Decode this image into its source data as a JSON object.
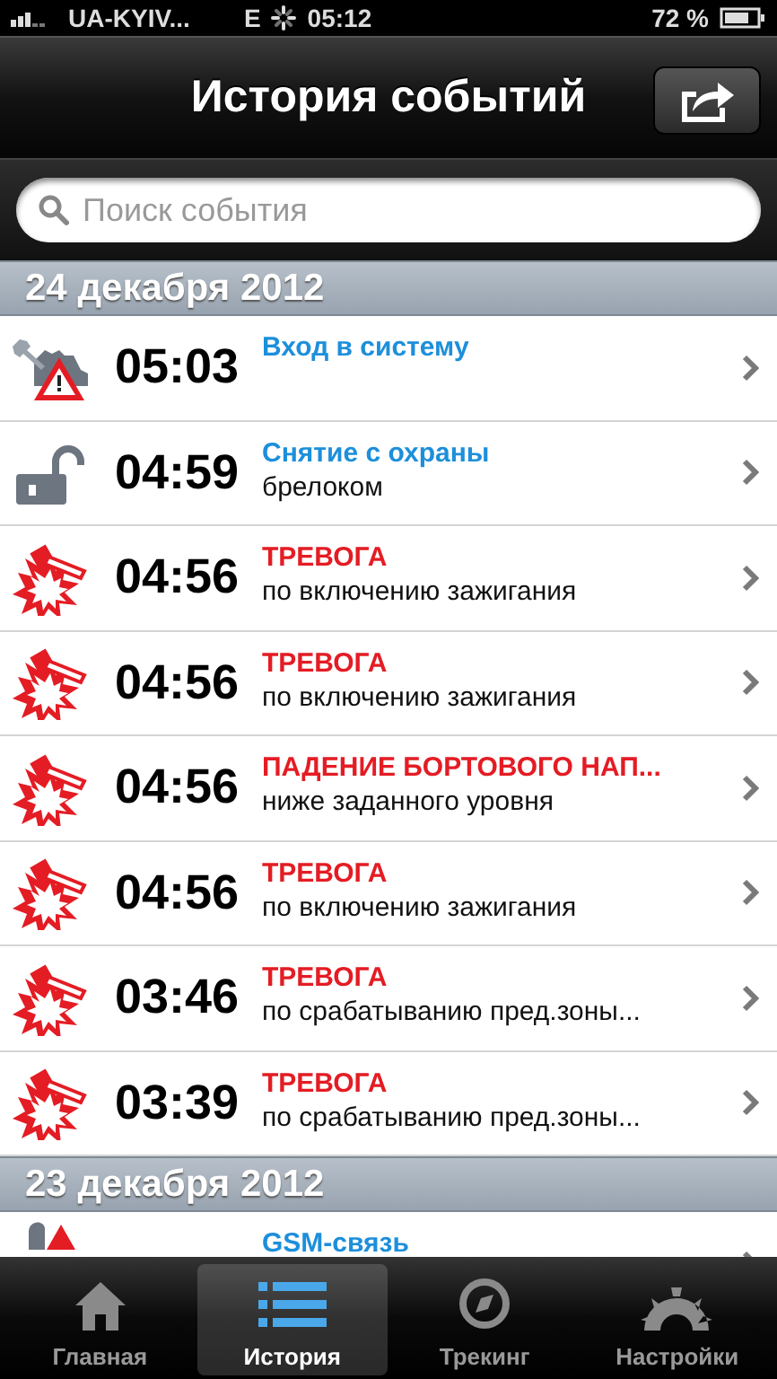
{
  "status_bar": {
    "carrier": "UA-KYIV...",
    "network": "E",
    "time": "05:12",
    "battery": "72 %"
  },
  "nav": {
    "title": "История событий"
  },
  "search": {
    "placeholder": "Поиск события"
  },
  "sections": [
    {
      "date": "24 декабря 2012",
      "events": [
        {
          "kind": "login",
          "time": "05:03",
          "title": "Вход в систему"
        },
        {
          "kind": "unlock",
          "time": "04:59",
          "title": "Снятие с охраны",
          "detail": "брелоком"
        },
        {
          "kind": "alarm",
          "time": "04:56",
          "title": "ТРЕВОГА",
          "detail": "по включению зажигания"
        },
        {
          "kind": "alarm",
          "time": "04:56",
          "title": "ТРЕВОГА",
          "detail": "по включению зажигания"
        },
        {
          "kind": "alarm",
          "time": "04:56",
          "title": "ПАДЕНИЕ БОРТОВОГО НАП...",
          "detail": "ниже заданного уровня"
        },
        {
          "kind": "alarm",
          "time": "04:56",
          "title": "ТРЕВОГА",
          "detail": "по включению зажигания"
        },
        {
          "kind": "alarm",
          "time": "03:46",
          "title": "ТРЕВОГА",
          "detail": "по срабатыванию пред.зоны..."
        },
        {
          "kind": "alarm",
          "time": "03:39",
          "title": "ТРЕВОГА",
          "detail": "по срабатыванию пред.зоны..."
        }
      ]
    },
    {
      "date": "23 декабря 2012",
      "events": [
        {
          "kind": "gsm",
          "title": "GSM-связь"
        }
      ]
    }
  ],
  "tabs": [
    {
      "kind": "home",
      "label": "Главная",
      "selected": false
    },
    {
      "kind": "history",
      "label": "История",
      "selected": true
    },
    {
      "kind": "tracking",
      "label": "Трекинг",
      "selected": false
    },
    {
      "kind": "settings",
      "label": "Настройки",
      "selected": false
    }
  ]
}
